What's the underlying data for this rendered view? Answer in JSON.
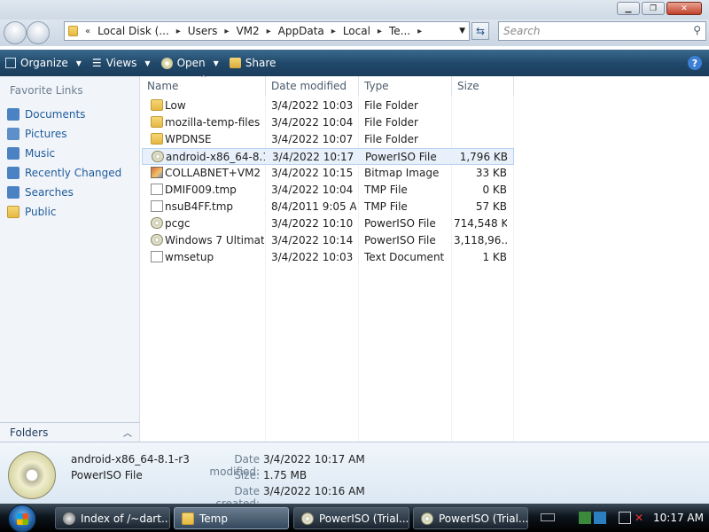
{
  "window": {
    "min": "▁",
    "max": "❐",
    "close": "✕"
  },
  "address": {
    "crumbs": [
      "Local Disk (...",
      "Users",
      "VM2",
      "AppData",
      "Local",
      "Te..."
    ],
    "search_placeholder": "Search"
  },
  "toolbar": {
    "organize": "Organize",
    "views": "Views",
    "open": "Open",
    "share": "Share",
    "help": "?"
  },
  "sidebar": {
    "heading": "Favorite Links",
    "items": [
      {
        "label": "Documents",
        "icon": "documents-icon",
        "color": "#4b82c4"
      },
      {
        "label": "Pictures",
        "icon": "pictures-icon",
        "color": "#5d8fc9"
      },
      {
        "label": "Music",
        "icon": "music-icon",
        "color": "#4b82c4"
      },
      {
        "label": "Recently Changed",
        "icon": "recent-icon",
        "color": "#4b82c4"
      },
      {
        "label": "Searches",
        "icon": "search-folder-icon",
        "color": "#4b82c4"
      },
      {
        "label": "Public",
        "icon": "folder-icon",
        "color": "#e6b843"
      }
    ],
    "folders_label": "Folders"
  },
  "columns": {
    "name": "Name",
    "date": "Date modified",
    "type": "Type",
    "size": "Size"
  },
  "files": [
    {
      "name": "Low",
      "date": "3/4/2022 10:03 ...",
      "type": "File Folder",
      "size": "",
      "icon": "folder"
    },
    {
      "name": "mozilla-temp-files",
      "date": "3/4/2022 10:04 ...",
      "type": "File Folder",
      "size": "",
      "icon": "folder"
    },
    {
      "name": "WPDNSE",
      "date": "3/4/2022 10:07 ...",
      "type": "File Folder",
      "size": "",
      "icon": "folder"
    },
    {
      "name": "android-x86_64-8.1...",
      "date": "3/4/2022 10:17 ...",
      "type": "PowerISO File",
      "size": "1,796 KB",
      "icon": "disc",
      "selected": true
    },
    {
      "name": "COLLABNET+VM2",
      "date": "3/4/2022 10:15 ...",
      "type": "Bitmap Image",
      "size": "33 KB",
      "icon": "bitmap"
    },
    {
      "name": "DMIF009.tmp",
      "date": "3/4/2022 10:04 ...",
      "type": "TMP File",
      "size": "0 KB",
      "icon": "file"
    },
    {
      "name": "nsuB4FF.tmp",
      "date": "8/4/2011 9:05 A...",
      "type": "TMP File",
      "size": "57 KB",
      "icon": "file"
    },
    {
      "name": "pcgc",
      "date": "3/4/2022 10:10 ...",
      "type": "PowerISO File",
      "size": "714,548 KB",
      "icon": "disc"
    },
    {
      "name": "Windows 7 Ultimat...",
      "date": "3/4/2022 10:14 ...",
      "type": "PowerISO File",
      "size": "3,118,96...",
      "icon": "disc"
    },
    {
      "name": "wmsetup",
      "date": "3/4/2022 10:03 ...",
      "type": "Text Document",
      "size": "1 KB",
      "icon": "file"
    }
  ],
  "details": {
    "name": "android-x86_64-8.1-r3",
    "type": "PowerISO File",
    "modified_label": "Date modified:",
    "modified": "3/4/2022 10:17 AM",
    "size_label": "Size:",
    "size": "1.75 MB",
    "created_label": "Date created:",
    "created": "3/4/2022 10:16 AM"
  },
  "taskbar": {
    "tasks": [
      {
        "label": "Index of /~dart...",
        "icon": "browser-icon"
      },
      {
        "label": "Temp",
        "icon": "folder-icon",
        "active": true
      },
      {
        "label": "PowerISO (Trial...",
        "icon": "poweriso-icon"
      },
      {
        "label": "PowerISO (Trial...",
        "icon": "poweriso-icon"
      }
    ],
    "clock": "10:17 AM"
  }
}
